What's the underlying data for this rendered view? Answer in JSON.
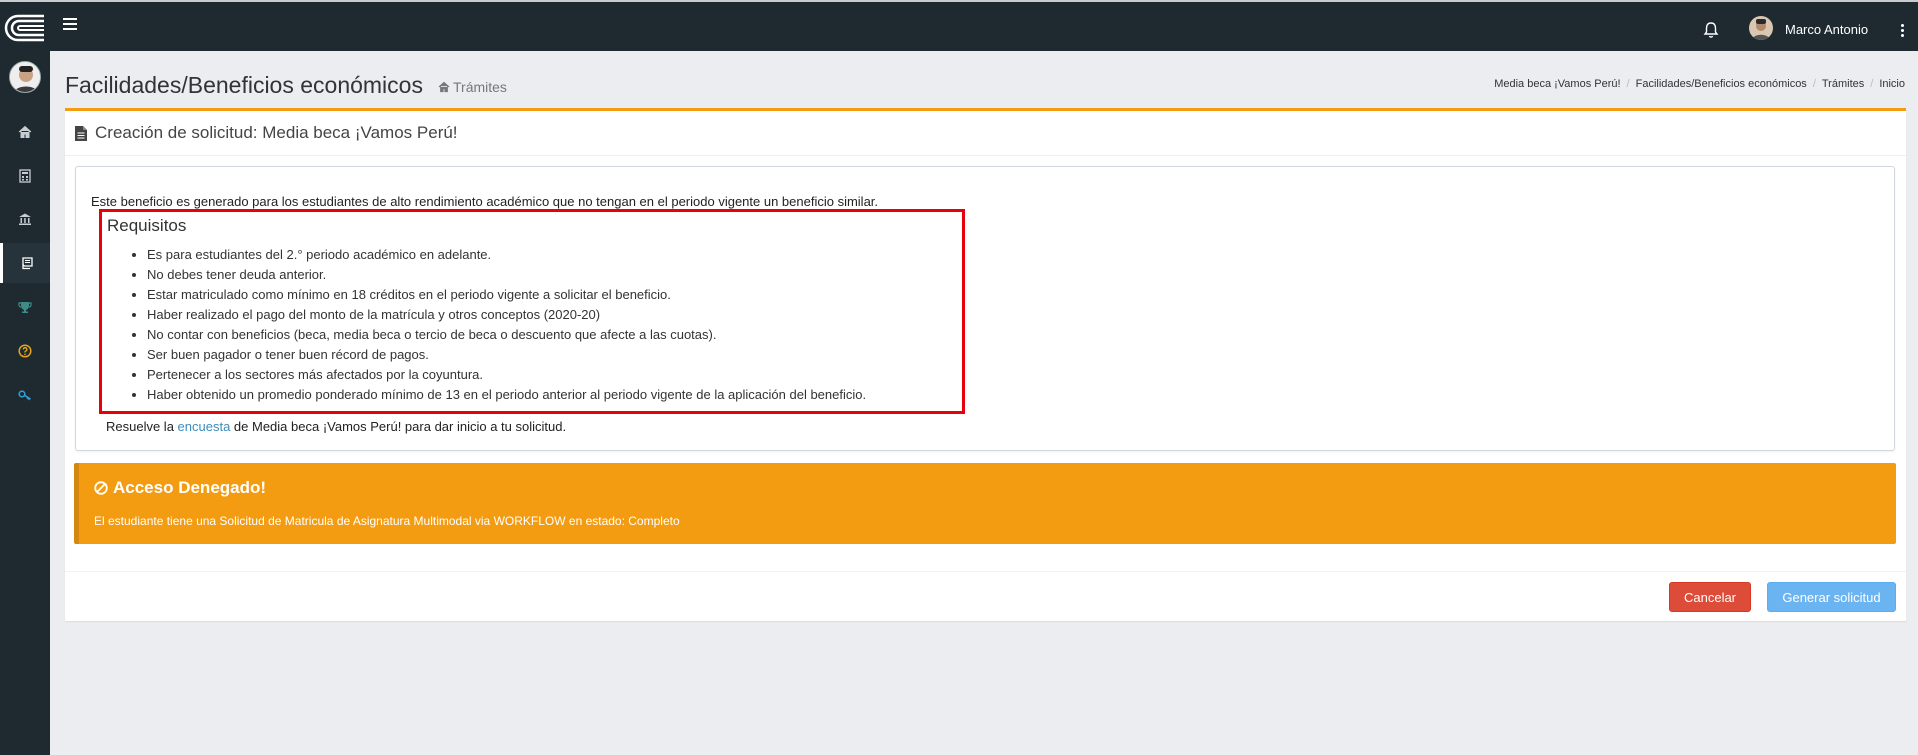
{
  "topbar": {
    "user_name": "Marco Antonio"
  },
  "header": {
    "title": "Facilidades/Beneficios económicos",
    "subtitle": "Trámites",
    "breadcrumb": [
      "Media beca ¡Vamos Perú!",
      "Facilidades/Beneficios económicos",
      "Trámites",
      "Inicio"
    ]
  },
  "card": {
    "title": "Creación de solicitud: Media beca ¡Vamos Perú!",
    "intro": "Este beneficio es generado para los estudiantes de alto rendimiento académico que no tengan en el periodo vigente un beneficio similar.",
    "requirements_title": "Requisitos",
    "requirements": [
      "Es para estudiantes del 2.° periodo académico en adelante.",
      "No debes tener deuda anterior.",
      "Estar matriculado como mínimo en 18 créditos en el periodo vigente a solicitar el beneficio.",
      "Haber realizado el pago del monto de la matrícula y otros conceptos (2020-20)",
      "No contar con beneficios (beca, media beca o tercio de beca o descuento que afecte a las cuotas).",
      "Ser buen pagador o tener buen récord de pagos.",
      "Pertenecer a los sectores más afectados por la coyuntura.",
      "Haber obtenido un promedio ponderado mínimo de 13 en el periodo anterior al periodo vigente de la aplicación del beneficio."
    ],
    "survey_prefix": "Resuelve la ",
    "survey_link": "encuesta",
    "survey_suffix": " de Media beca ¡Vamos Perú! para dar inicio a tu solicitud."
  },
  "alert": {
    "title": "Acceso Denegado!",
    "text": "El estudiante tiene una Solicitud de Matricula de Asignatura Multimodal via WORKFLOW en estado: Completo"
  },
  "buttons": {
    "cancel": "Cancelar",
    "generate": "Generar solicitud"
  },
  "colors": {
    "sidebar": "#1f2a30",
    "accent_orange": "#f39c12",
    "highlight_red": "#e8000b",
    "danger": "#dd4b39",
    "primary_light": "#6ab4f2"
  },
  "sidebar_icons": [
    "home-icon",
    "calculator-icon",
    "institution-icon",
    "certificate-icon",
    "trophy-icon",
    "help-circle-icon",
    "key-icon"
  ]
}
